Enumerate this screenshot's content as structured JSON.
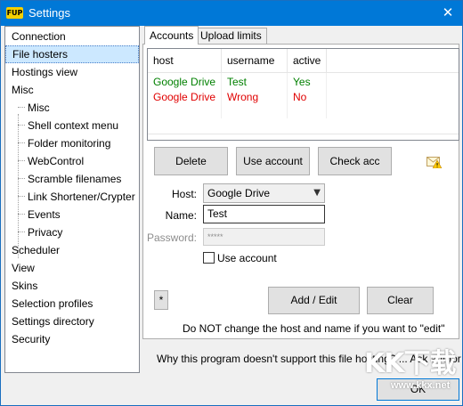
{
  "window": {
    "title": "Settings",
    "app_icon": "FUP",
    "close_glyph": "✕"
  },
  "sidebar": {
    "items": [
      {
        "label": "Connection",
        "level": 0
      },
      {
        "label": "File hosters",
        "level": 0,
        "selected": true
      },
      {
        "label": "Hostings view",
        "level": 0
      },
      {
        "label": "Misc",
        "level": 0
      },
      {
        "label": "Misc",
        "level": 1
      },
      {
        "label": "Shell context menu",
        "level": 1
      },
      {
        "label": "Folder monitoring",
        "level": 1
      },
      {
        "label": "WebControl",
        "level": 1
      },
      {
        "label": "Scramble filenames",
        "level": 1
      },
      {
        "label": "Link Shortener/Crypter",
        "level": 1
      },
      {
        "label": "Events",
        "level": 1
      },
      {
        "label": "Privacy",
        "level": 1
      },
      {
        "label": "Scheduler",
        "level": 0
      },
      {
        "label": "View",
        "level": 0
      },
      {
        "label": "Skins",
        "level": 0
      },
      {
        "label": "Selection profiles",
        "level": 0
      },
      {
        "label": "Settings directory",
        "level": 0
      },
      {
        "label": "Security",
        "level": 0
      }
    ]
  },
  "tabs": [
    {
      "label": "Accounts",
      "active": true
    },
    {
      "label": "Upload limits",
      "active": false
    }
  ],
  "accounts_table": {
    "columns": [
      "host",
      "username",
      "active"
    ],
    "rows": [
      {
        "host": "Google Drive",
        "username": "Test",
        "active": "Yes",
        "status": "ok"
      },
      {
        "host": "Google Drive",
        "username": "Wrong",
        "active": "No",
        "status": "error"
      }
    ]
  },
  "buttons": {
    "delete": "Delete",
    "use_account": "Use account",
    "check_acc": "Check acc",
    "star": "*",
    "add_edit": "Add / Edit",
    "clear": "Clear",
    "ok": "OK"
  },
  "form": {
    "host_label": "Host:",
    "host_value": "Google Drive",
    "name_label": "Name:",
    "name_value": "Test",
    "password_label": "Password:",
    "password_value": "*****",
    "use_account_label": "Use account",
    "use_account_checked": false
  },
  "notes": {
    "warning": "Do NOT change the host and name if you want to \"edit\"",
    "footer": "Why this program doesn't support this file hosting? ... Ask author :)"
  },
  "watermark": {
    "text": "KK下载",
    "url": "www.kkx.net"
  },
  "colors": {
    "title_bar": "#0078d7",
    "selection": "#cce8ff",
    "ok_text": "#008000",
    "error_text": "#e00000"
  },
  "icons": {
    "app": "app-logo-icon",
    "close": "close-icon",
    "dropdown": "chevron-down-icon",
    "mail": "mail-warning-icon"
  }
}
